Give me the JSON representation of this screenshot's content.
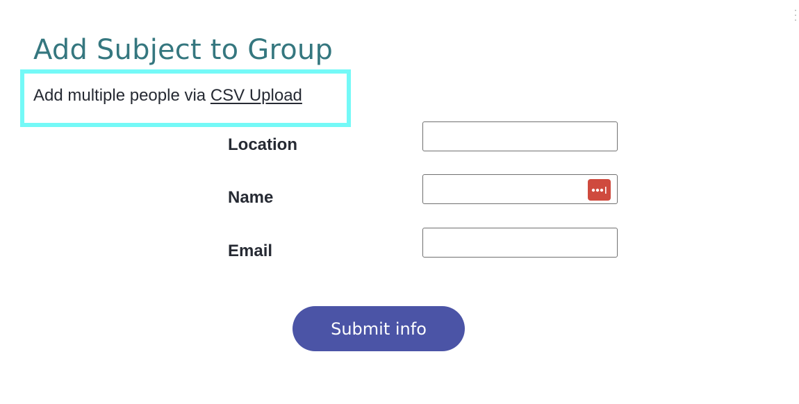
{
  "page": {
    "title": "Add Subject to Group"
  },
  "csv_upload": {
    "prefix_text": "Add multiple people via ",
    "link_label": "CSV Upload",
    "highlight_color": "#74f9f7"
  },
  "form": {
    "fields": [
      {
        "label": "Location",
        "value": "",
        "placeholder": ""
      },
      {
        "label": "Name",
        "value": "",
        "placeholder": ""
      },
      {
        "label": "Email",
        "value": "",
        "placeholder": ""
      }
    ],
    "password_manager_icon": "password-dots-icon",
    "submit_label": "Submit info"
  },
  "colors": {
    "title": "#35777f",
    "text": "#262a33",
    "submit_button": "#4b54a6",
    "password_manager_icon": "#cf4a3e"
  }
}
